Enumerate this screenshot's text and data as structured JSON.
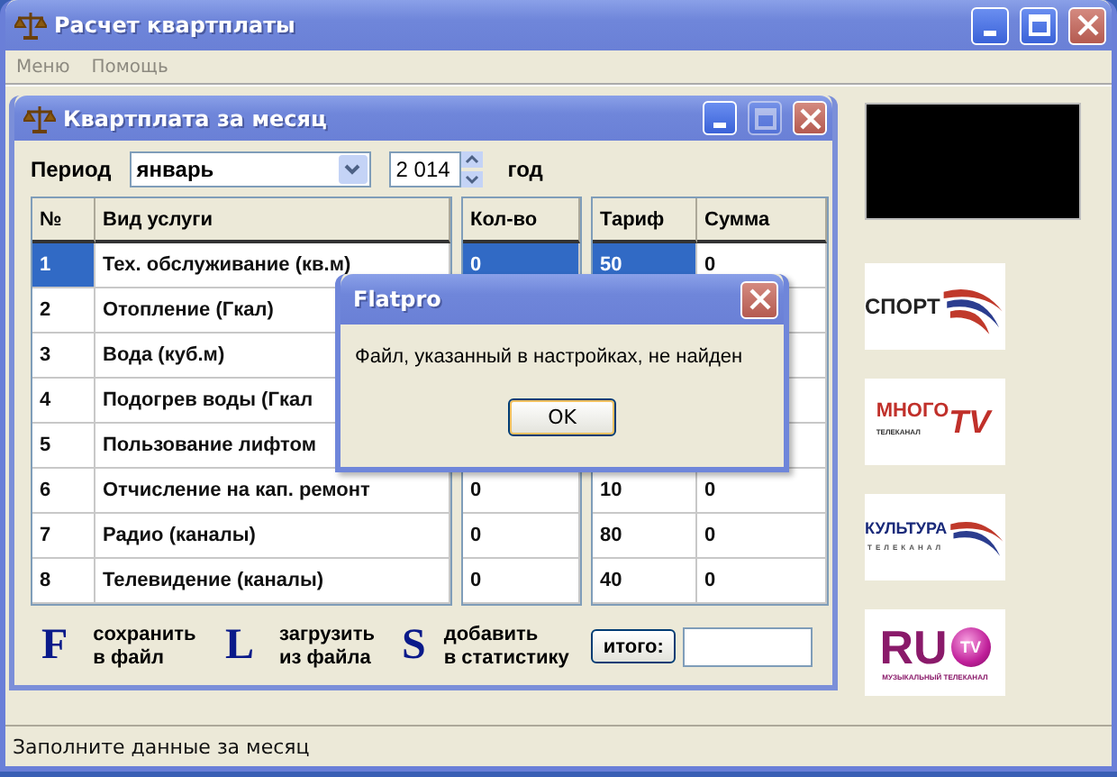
{
  "window": {
    "title": "Расчет квартплаты",
    "buttons": [
      {
        "kind": "minimize",
        "disabled": false
      },
      {
        "kind": "maximize",
        "disabled": false
      },
      {
        "kind": "close",
        "disabled": false
      }
    ]
  },
  "menu": [
    {
      "label": "Меню",
      "disabled": true
    },
    {
      "label": "Помощь",
      "disabled": true
    }
  ],
  "child_window": {
    "title": "Квартплата за месяц",
    "buttons": [
      {
        "kind": "minimize",
        "disabled": false
      },
      {
        "kind": "maximize",
        "disabled": true
      },
      {
        "kind": "close",
        "disabled": false
      }
    ],
    "period": {
      "label": "Период",
      "month": "январь",
      "year": "2 014",
      "year_label": "год"
    },
    "table": {
      "columns": [
        "№",
        "Вид услуги",
        "Кол-во",
        "Тариф",
        "Сумма"
      ],
      "rows": [
        {
          "num": "1",
          "name": "Тех. обслуживание (кв.м)",
          "qty": "0",
          "tariff": "50",
          "sum": "0",
          "selected": true
        },
        {
          "num": "2",
          "name": "Отопление (Гкал)",
          "selected": false
        },
        {
          "num": "3",
          "name": "Вода (куб.м)",
          "selected": false
        },
        {
          "num": "4",
          "name": "Подогрев воды (Гкал",
          "selected": false
        },
        {
          "num": "5",
          "name": "Пользование лифтом",
          "selected": false
        },
        {
          "num": "6",
          "name": "Отчисление на кап. ремонт",
          "qty": "0",
          "tariff": "10",
          "sum": "0",
          "selected": false
        },
        {
          "num": "7",
          "name": "Радио (каналы)",
          "qty": "0",
          "tariff": "80",
          "sum": "0",
          "selected": false
        },
        {
          "num": "8",
          "name": "Телевидение (каналы)",
          "qty": "0",
          "tariff": "40",
          "sum": "0",
          "selected": false
        }
      ]
    },
    "actions": [
      {
        "key": "F",
        "lines": [
          "сохранить",
          "в файл"
        ]
      },
      {
        "key": "L",
        "lines": [
          "загрузить",
          "из файла"
        ]
      },
      {
        "key": "S",
        "lines": [
          "добавить",
          "в статистику"
        ]
      }
    ],
    "total_button": "итого:"
  },
  "logos": [
    {
      "kind": "screen"
    },
    {
      "kind": "sport",
      "text": "СПОРТ"
    },
    {
      "kind": "mnogo",
      "text": "МНОГО",
      "badge": "TV",
      "sub": "ТЕЛЕКАНАЛ"
    },
    {
      "kind": "kultura",
      "text": "КУЛЬТУРА",
      "sub": "ТЕЛЕКАНАЛ"
    },
    {
      "kind": "rutv",
      "text": "RU",
      "badge": "TV",
      "sub": "МУЗЫКАЛЬНЫЙ ТЕЛЕКАНАЛ"
    }
  ],
  "status_bar": "Заполните данные за месяц",
  "dialog": {
    "title": "Flatpro",
    "message": "Файл, указанный в настройках, не найден",
    "button": "OK"
  }
}
